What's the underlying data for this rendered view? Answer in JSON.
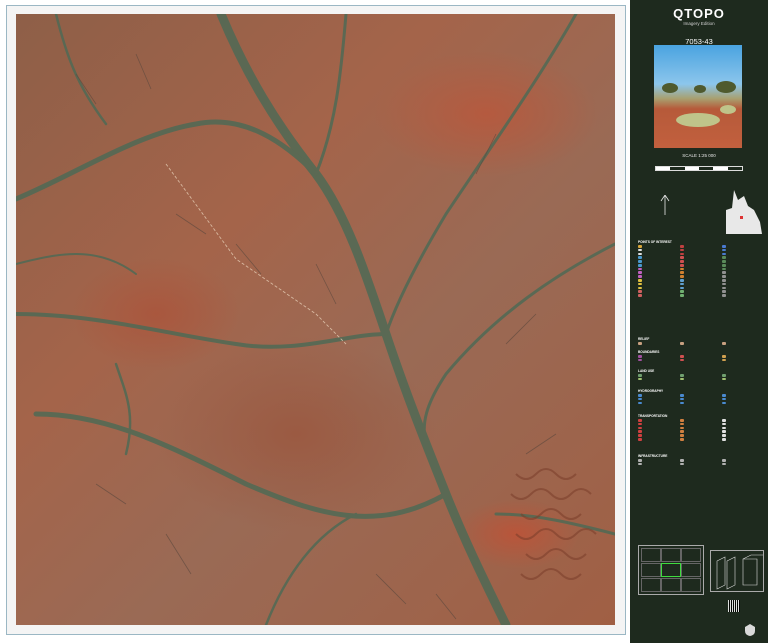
{
  "header": {
    "title": "QTOPO",
    "subtitle": "Imagery Edition",
    "sheet_number": "7053-43"
  },
  "scale": {
    "label": "SCALE 1:25 000"
  },
  "legend": {
    "sections": [
      {
        "heading": "POINTS OF INTEREST"
      },
      {
        "heading": "RELIEF"
      },
      {
        "heading": "BOUNDARIES"
      },
      {
        "heading": "LAND USE"
      },
      {
        "heading": "HYDROGRAPHY"
      },
      {
        "heading": "TRANSPORTATION"
      },
      {
        "heading": "INFRASTRUCTURE"
      }
    ]
  },
  "colors": {
    "sidebar_bg": "#1e2a1e",
    "frame_border": "#9bb7c4",
    "current_sheet_outline": "#3fdc3f"
  }
}
